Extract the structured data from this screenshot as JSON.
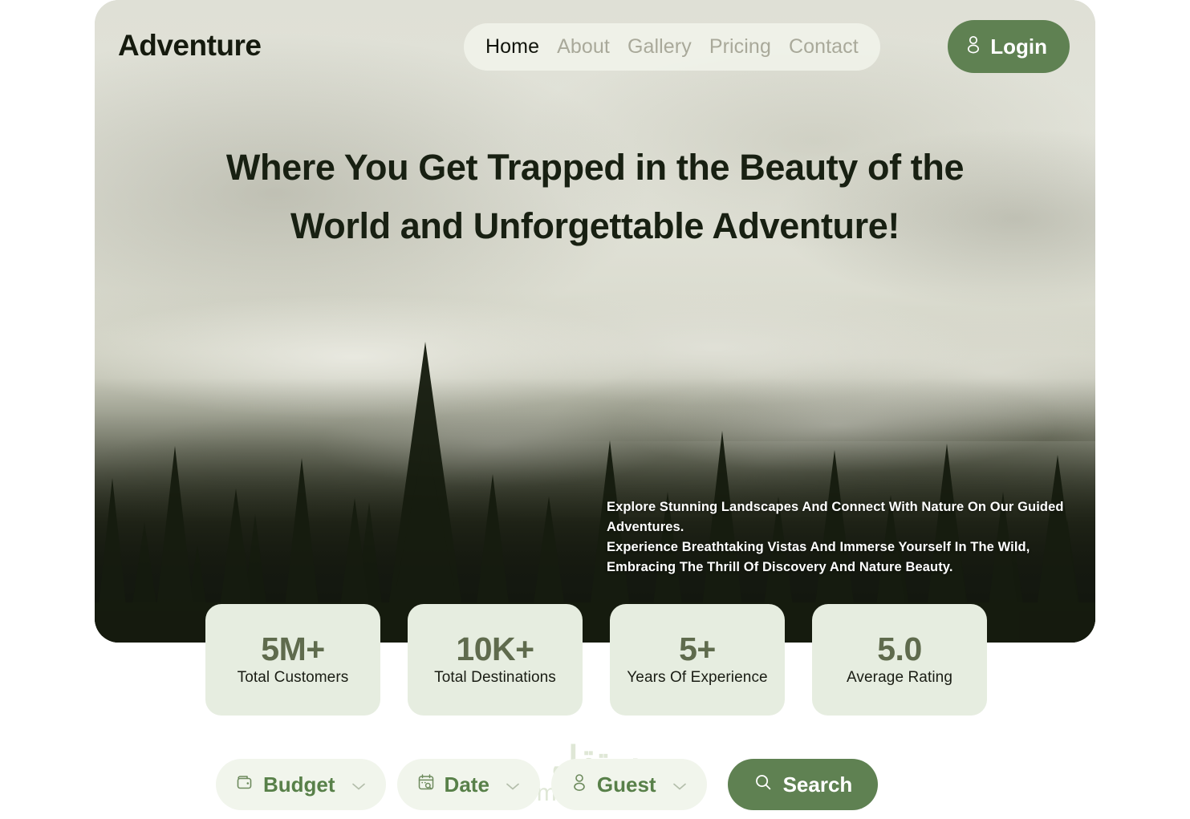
{
  "brand": {
    "name": "Adventure"
  },
  "nav": {
    "items": [
      {
        "label": "Home",
        "active": true
      },
      {
        "label": "About",
        "active": false
      },
      {
        "label": "Gallery",
        "active": false
      },
      {
        "label": "Pricing",
        "active": false
      },
      {
        "label": "Contact",
        "active": false
      }
    ]
  },
  "login": {
    "label": "Login",
    "icon": "user-icon"
  },
  "hero": {
    "headline": "Where You Get Trapped in the Beauty of the World and Unforgettable Adventure!",
    "paragraph_1": "Explore Stunning Landscapes And Connect With Nature On Our Guided Adventures.",
    "paragraph_2": "Experience Breathtaking Vistas And Immerse Yourself In The Wild, Embracing The Thrill Of Discovery And Nature Beauty.",
    "image_alt": "Misty pine forest and mountain ridges"
  },
  "stats": [
    {
      "value": "5M+",
      "label": "Total Customers"
    },
    {
      "value": "10K+",
      "label": "Total Destinations"
    },
    {
      "value": "5+",
      "label": "Years Of Experience"
    },
    {
      "value": "5.0",
      "label": "Average Rating"
    }
  ],
  "search": {
    "filters": [
      {
        "label": "Budget",
        "icon": "wallet-icon"
      },
      {
        "label": "Date",
        "icon": "calendar-search-icon"
      },
      {
        "label": "Guest",
        "icon": "user-icon"
      }
    ],
    "button": {
      "label": "Search",
      "icon": "search-icon"
    }
  },
  "watermark": {
    "arabic": "مستقل",
    "latin": "mostaql.com"
  },
  "colors": {
    "brand_green": "#5f8152",
    "filter_text_green": "#588049",
    "stat_number": "#5f6b4d",
    "stat_card_bg": "#e6ede0",
    "filter_pill_bg": "#f1f5ec",
    "nav_pill_bg": "#f3f5ec",
    "nav_inactive": "#a9a99a",
    "nav_active": "#11140b",
    "headline": "#182012",
    "page_bg": "#ffffff",
    "watermark": "#dfe7d6"
  }
}
